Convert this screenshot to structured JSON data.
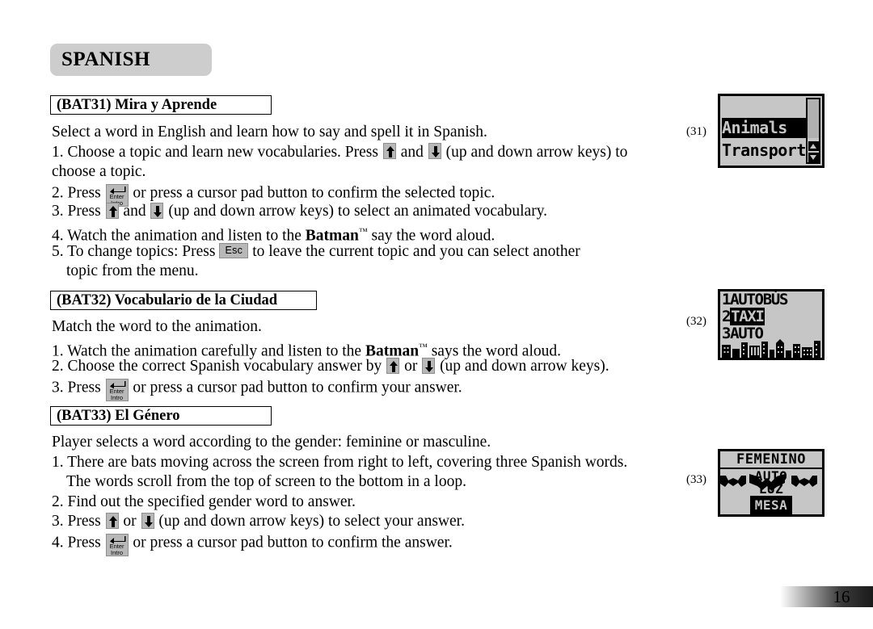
{
  "page": {
    "title": "SPANISH",
    "number": "16"
  },
  "sections": [
    {
      "heading": "(BAT31) Mira y Aprende",
      "figref": "(31)",
      "lines": [
        {
          "id": "s1l0",
          "text": "Select a word in English and learn how to say and spell it in Spanish."
        },
        {
          "id": "s1l1a",
          "text": "1. Choose a topic and learn new vocabularies. Press "
        },
        {
          "id": "s1l1b",
          "text": " and "
        },
        {
          "id": "s1l1c",
          "text": " (up and down arrow keys) to"
        },
        {
          "id": "s1l2",
          "text": "choose a topic."
        },
        {
          "id": "s1l3a",
          "text": "2. Press "
        },
        {
          "id": "s1l3b",
          "text": " or press a cursor pad button to confirm the selected topic."
        },
        {
          "id": "s1l4a",
          "text": "3. Press "
        },
        {
          "id": "s1l4b",
          "text": " and "
        },
        {
          "id": "s1l4c",
          "text": " (up and down arrow keys) to select an animated vocabulary."
        },
        {
          "id": "s1l5a",
          "text": "4. Watch the animation and listen to the "
        },
        {
          "id": "s1l5b",
          "text": "Batman"
        },
        {
          "id": "s1l5c",
          "text": " say the word aloud."
        },
        {
          "id": "s1l6a",
          "text": "5. To change topics: Press "
        },
        {
          "id": "s1l6b",
          "text": " to leave the current topic and you can select another"
        },
        {
          "id": "s1l7",
          "text": "topic from the menu."
        }
      ]
    },
    {
      "heading": "(BAT32) Vocabulario de la Ciudad",
      "figref": "(32)",
      "lines": [
        {
          "id": "s2l0",
          "text": "Match the word to the animation."
        },
        {
          "id": "s2l1a",
          "text": "1. Watch the animation carefully and listen to the "
        },
        {
          "id": "s2l1b",
          "text": "Batman"
        },
        {
          "id": "s2l1c",
          "text": " says the word aloud."
        },
        {
          "id": "s2l2a",
          "text": "2. Choose the correct Spanish vocabulary answer by "
        },
        {
          "id": "s2l2b",
          "text": " or "
        },
        {
          "id": "s2l2c",
          "text": " (up and down arrow keys)."
        },
        {
          "id": "s2l3a",
          "text": "3. Press "
        },
        {
          "id": "s2l3b",
          "text": " or press a cursor pad button to confirm your answer."
        }
      ]
    },
    {
      "heading": "(BAT33) El Género",
      "figref": "(33)",
      "lines": [
        {
          "id": "s3l0",
          "text": "Player selects a word according to the gender: feminine or masculine."
        },
        {
          "id": "s3l1",
          "text": "1. There are bats moving across the screen from right to left, covering three Spanish words."
        },
        {
          "id": "s3l2",
          "text": "The words scroll from the top of screen to the bottom in a loop."
        },
        {
          "id": "s3l3",
          "text": "2. Find out the specified gender word to answer."
        },
        {
          "id": "s3l4a",
          "text": "3. Press "
        },
        {
          "id": "s3l4b",
          "text": " or "
        },
        {
          "id": "s3l4c",
          "text": " (up and down arrow keys) to select your answer."
        },
        {
          "id": "s3l5a",
          "text": "4. Press "
        },
        {
          "id": "s3l5b",
          "text": " or press a cursor pad button to confirm the answer."
        }
      ]
    }
  ],
  "keys": {
    "esc_label": "Esc",
    "enter_line1": "Enter",
    "enter_line2": "Intro"
  },
  "screens": {
    "topic_menu": {
      "rows": [
        {
          "label": "",
          "selected": false
        },
        {
          "label": "Animals",
          "selected": true
        },
        {
          "label": "Transport",
          "selected": false
        }
      ]
    },
    "vocabulary": {
      "rows": [
        {
          "num": "1",
          "word": "AUTOBÚS",
          "selected": false
        },
        {
          "num": "2",
          "word": "TAXI",
          "selected": true
        },
        {
          "num": "3",
          "word": "AUTO",
          "selected": false
        }
      ]
    },
    "gender": {
      "header": "FEMENINO",
      "word_top": "AUTO",
      "word_mid": "LUZ",
      "word_bottom": "MESA"
    }
  },
  "colors": {
    "title_bar": "#cdcdcd",
    "lcd_background": "#c6c6c6",
    "key_face": "#b8b8b8",
    "ink": "#000000"
  }
}
